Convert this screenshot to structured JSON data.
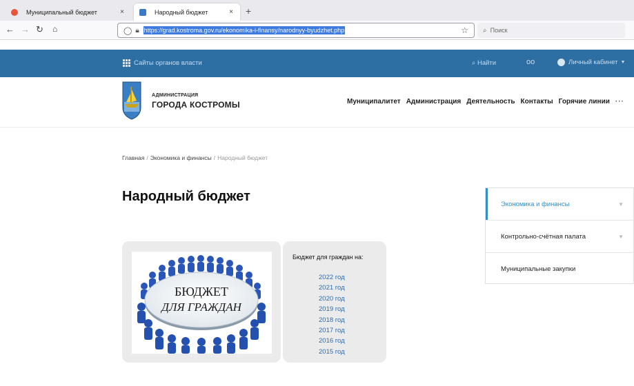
{
  "browser": {
    "tabs": [
      {
        "title": "Муниципальный бюджет",
        "favicon_color": "#e8553a"
      },
      {
        "title": "Народный бюджет",
        "favicon_color": "#3b78c6"
      }
    ],
    "tab_close_glyph": "×",
    "new_tab_glyph": "+",
    "url": "https://grad.kostroma.gov.ru/ekonomika-i-finansy/narodnyy-byudzhet.php",
    "search_placeholder": "Поиск"
  },
  "site_bar": {
    "sites_label": "Сайты органов власти",
    "find_label": "Найти",
    "glasses_glyph": "oo",
    "cabinet_label": "Личный кабинет"
  },
  "header": {
    "brand_small": "АДМИНИСТРАЦИЯ",
    "brand_big": "ГОРОДА КОСТРОМЫ",
    "menu": [
      "Муниципалитет",
      "Администрация",
      "Деятельность",
      "Контакты",
      "Горячие линии"
    ],
    "more_glyph": "···"
  },
  "breadcrumb": {
    "items": [
      "Главная",
      "Экономика и финансы"
    ],
    "current": "Народный бюджет",
    "separator": "/"
  },
  "page": {
    "title": "Народный бюджет",
    "poster_line1": "БЮДЖЕТ",
    "poster_line2": "ДЛЯ ГРАЖДАН",
    "budget_heading": "Бюджет для граждан на:",
    "years": [
      "2022 год",
      "2021 год",
      "2020 год",
      "2019 год",
      "2018 год",
      "2017 год",
      "2016 год",
      "2015 год"
    ]
  },
  "side_menu": {
    "items": [
      {
        "label": "Экономика и финансы",
        "active": true,
        "has_arrow": true
      },
      {
        "label": "Контрольно-счётная палата",
        "active": false,
        "has_arrow": true
      },
      {
        "label": "Муниципальные закупки",
        "active": false,
        "has_arrow": false
      }
    ],
    "arrow_glyph": "▼"
  },
  "colors": {
    "site_bar": "#2e6fa3",
    "link": "#2b6cb0",
    "active": "#2e8fcb"
  }
}
